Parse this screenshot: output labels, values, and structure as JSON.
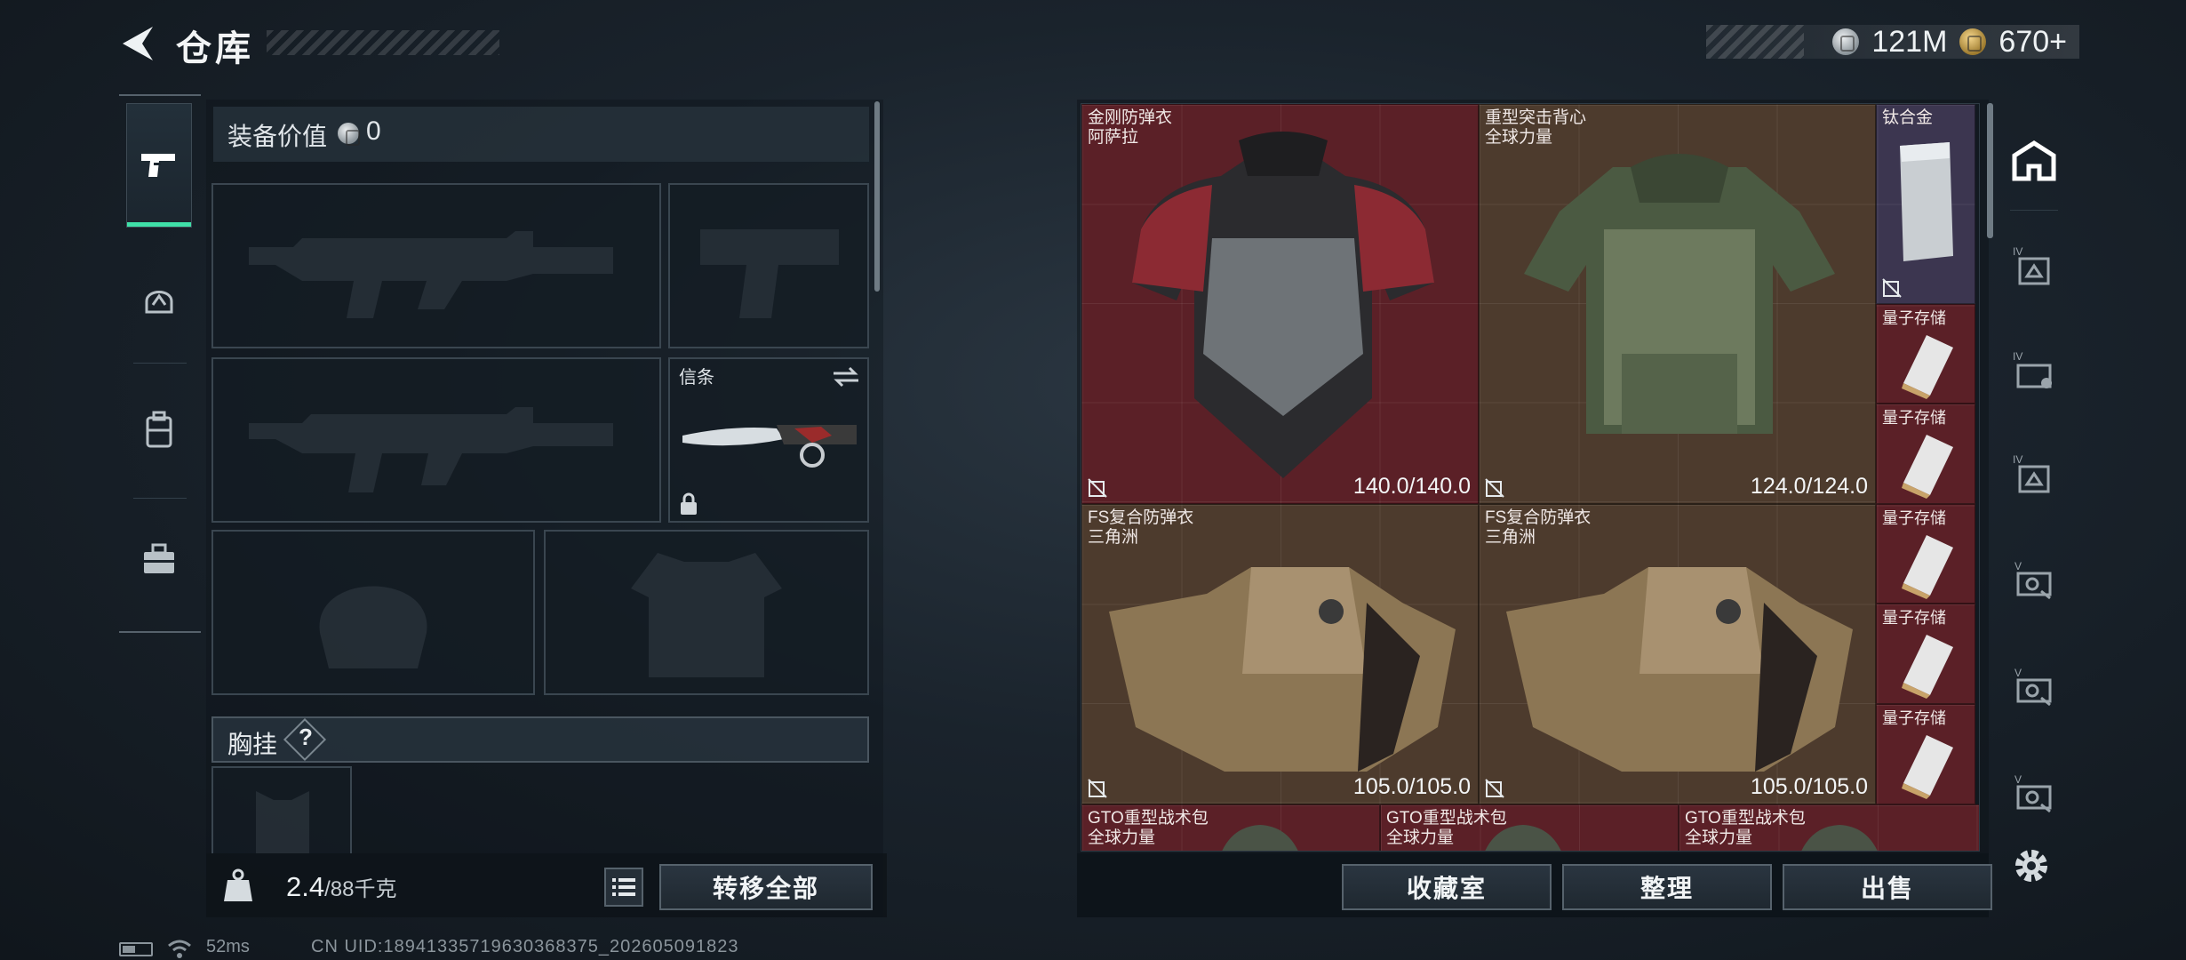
{
  "header": {
    "title": "仓库",
    "currency_silver": "121M",
    "currency_gold": "670+"
  },
  "equipment": {
    "value_label": "装备价值",
    "value": "0",
    "knife_label": "信条",
    "rig_label": "胸挂",
    "rig_help": "?"
  },
  "weight": {
    "current": "2.4",
    "max": "/88千克"
  },
  "buttons": {
    "transfer_all": "转移全部",
    "collection": "收藏室",
    "sort": "整理",
    "sell": "出售"
  },
  "storage_items": [
    {
      "name": "金刚防弹衣",
      "maker": "阿萨拉",
      "durability": "140.0/140.0",
      "rarity": "red"
    },
    {
      "name": "重型突击背心",
      "maker": "全球力量",
      "durability": "124.0/124.0",
      "rarity": "gold"
    },
    {
      "name": "钛合金",
      "maker": "",
      "durability": "",
      "rarity": "purple"
    },
    {
      "name": "量子存储",
      "maker": "",
      "durability": "",
      "rarity": "red"
    },
    {
      "name": "量子存储",
      "maker": "",
      "durability": "",
      "rarity": "red"
    },
    {
      "name": "FS复合防弹衣",
      "maker": "三角洲",
      "durability": "105.0/105.0",
      "rarity": "gold"
    },
    {
      "name": "FS复合防弹衣",
      "maker": "三角洲",
      "durability": "105.0/105.0",
      "rarity": "gold"
    },
    {
      "name": "量子存储",
      "maker": "",
      "durability": "",
      "rarity": "red"
    },
    {
      "name": "量子存储",
      "maker": "",
      "durability": "",
      "rarity": "red"
    },
    {
      "name": "量子存储",
      "maker": "",
      "durability": "",
      "rarity": "red"
    },
    {
      "name": "GTO重型战术包",
      "maker": "全球力量",
      "durability": "",
      "rarity": "red"
    },
    {
      "name": "GTO重型战术包",
      "maker": "全球力量",
      "durability": "",
      "rarity": "red"
    },
    {
      "name": "GTO重型战术包",
      "maker": "全球力量",
      "durability": "",
      "rarity": "red"
    }
  ],
  "colors": {
    "accent": "#3fe0a8",
    "rarity_red": "#5b2027",
    "rarity_gold": "#4d3b2d",
    "rarity_purple": "#3c3650"
  },
  "icons": {
    "back": "back-arrow-icon",
    "rail": [
      "pistol-icon",
      "helmet-icon",
      "backpack-icon",
      "toolbox-icon"
    ],
    "filters": [
      "all-items-icon",
      "armor-filter-icon",
      "vest-filter-icon",
      "rig-filter-icon",
      "key-filter-icon",
      "key-filter-icon",
      "key-filter-icon"
    ],
    "settings": "gear-icon"
  },
  "status": {
    "ping": "52ms",
    "uid": "CN UID:18941335719630368375_202605091823"
  }
}
